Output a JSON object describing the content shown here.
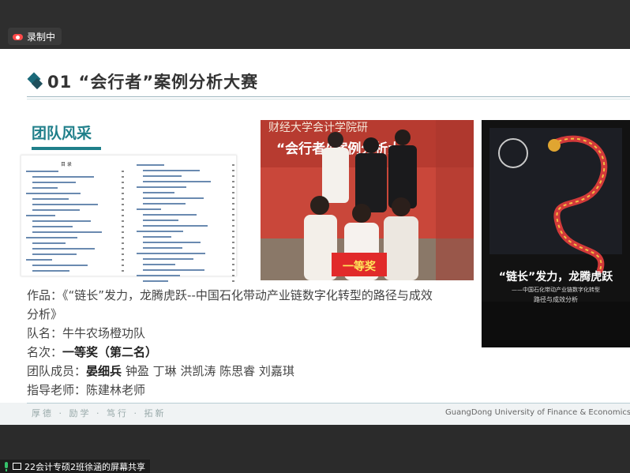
{
  "recording": {
    "label": "录制中"
  },
  "slide": {
    "title": "01 “会行者”案例分析大赛",
    "section": "团队风采",
    "doc_title": "目 录",
    "work_label": "作品：",
    "work_value": "《“链长”发力，龙腾虎跃--中国石化带动产业链数字化转型的路径与成效",
    "work_value_2": "分析》",
    "team_label": "队名：",
    "team_value": "牛牛农场橙功队",
    "rank_label": "名次：",
    "rank_value": "一等奖（第二名）",
    "members_label": "团队成员：",
    "members_lead": "晏细兵",
    "members_rest": "钟盈 丁琳 洪凯涛 陈思睿 刘嘉琪",
    "advisor_label": "指导老师：",
    "advisor_value": "陈建林老师",
    "photo_banner": "“会行者”案例分析大",
    "photo_banner_top": "财经大学会计学院研",
    "photo_sign": "一等奖",
    "poster_headline": "“链长”发力，龙腾虎跃",
    "poster_sub": "——中国石化带动产业链数字化转型",
    "poster_sub2": "路径与成效分析",
    "footer_left": "厚德 · 励学 · 笃行 · 拓新",
    "footer_right": "GuangDong University of Finance & Economics"
  },
  "share": {
    "label": "22会计专硕2班徐涵的屏幕共享"
  },
  "colors": {
    "accent": "#1f7f8a",
    "photo_bg": "#c54a3c",
    "rec": "#ff4a4a",
    "mic": "#35c16b"
  }
}
